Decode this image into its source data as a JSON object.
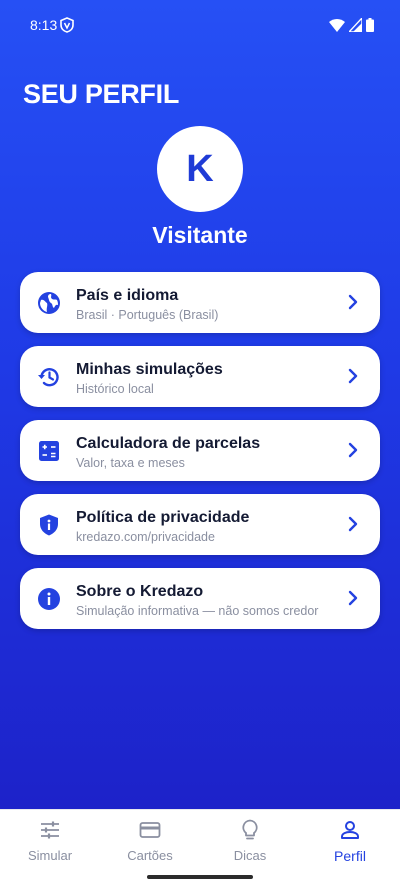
{
  "status_bar": {
    "time": "8:13"
  },
  "profile": {
    "title": "SEU PERFIL",
    "avatar_initial": "K",
    "user_name": "Visitante"
  },
  "menu": [
    {
      "title": "País e idioma",
      "subtitle": "Brasil · Português (Brasil)",
      "icon": "globe-icon"
    },
    {
      "title": "Minhas simulações",
      "subtitle": "Histórico local",
      "icon": "history-icon"
    },
    {
      "title": "Calculadora de parcelas",
      "subtitle": "Valor, taxa e meses",
      "icon": "calculator-icon"
    },
    {
      "title": "Política de privacidade",
      "subtitle": "kredazo.com/privacidade",
      "icon": "privacy-shield-icon"
    },
    {
      "title": "Sobre o Kredazo",
      "subtitle": "Simulação informativa — não somos credor",
      "icon": "info-icon"
    }
  ],
  "nav": {
    "items": [
      {
        "label": "Simular",
        "icon": "sliders-icon"
      },
      {
        "label": "Cartões",
        "icon": "card-icon"
      },
      {
        "label": "Dicas",
        "icon": "lightbulb-icon"
      },
      {
        "label": "Perfil",
        "icon": "person-icon"
      }
    ],
    "active": "Perfil"
  },
  "colors": {
    "accent": "#2442e0",
    "gradient_top": "#2650f5",
    "gradient_bottom": "#1d22c9",
    "title_text": "#141a33",
    "muted_text": "#8a8fa0"
  }
}
